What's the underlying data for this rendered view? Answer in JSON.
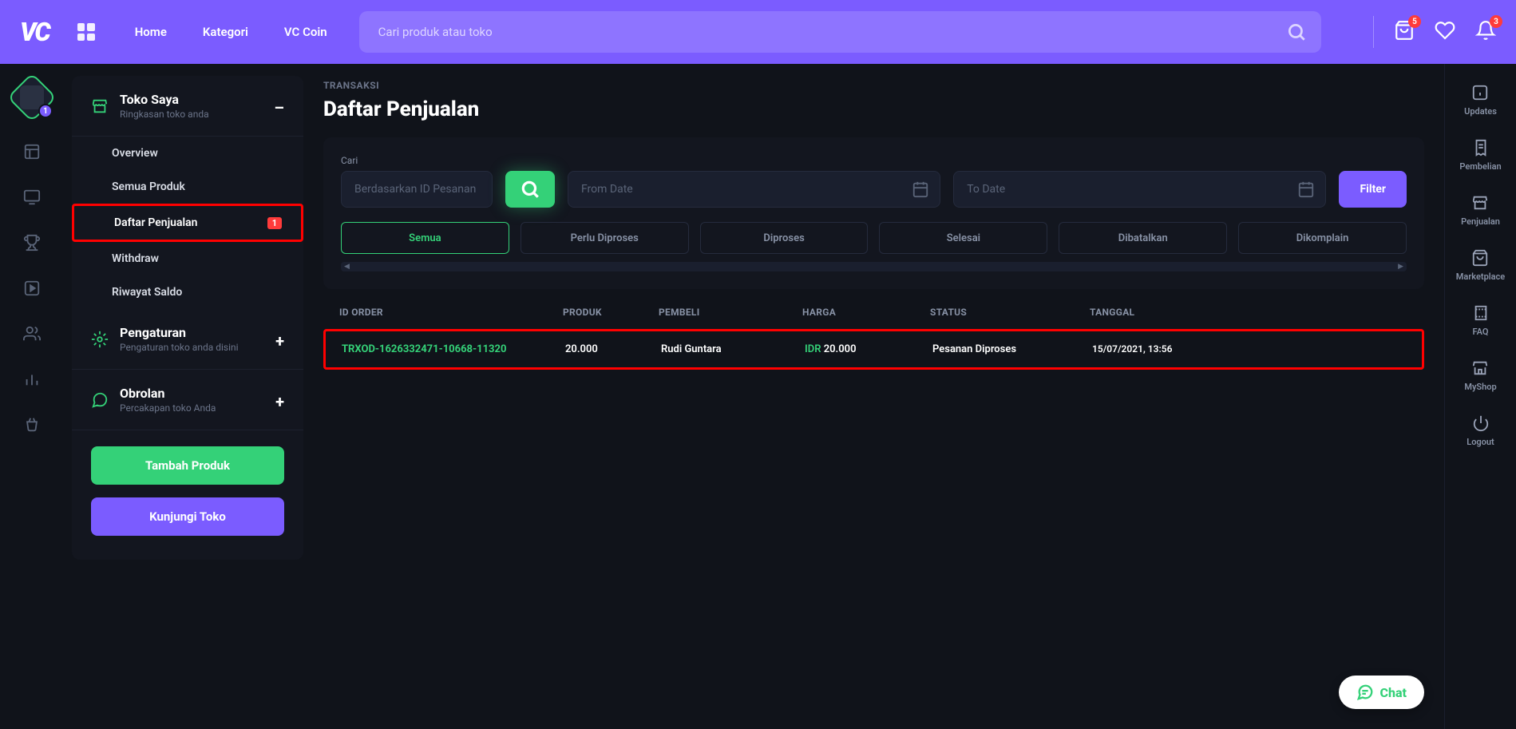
{
  "topnav": {
    "links": [
      "Home",
      "Kategori",
      "VC Coin"
    ],
    "search_placeholder": "Cari produk atau toko",
    "cart_badge": "5",
    "bell_badge": "3"
  },
  "left_rail": {
    "avatar_badge": "1"
  },
  "sidebar": {
    "sections": [
      {
        "title": "Toko Saya",
        "subtitle": "Ringkasan toko anda",
        "collapse": "–"
      },
      {
        "title": "Pengaturan",
        "subtitle": "Pengaturan toko anda disini",
        "collapse": "+"
      },
      {
        "title": "Obrolan",
        "subtitle": "Percakapan toko Anda",
        "collapse": "+"
      }
    ],
    "menu": [
      {
        "label": "Overview"
      },
      {
        "label": "Semua Produk"
      },
      {
        "label": "Daftar Penjualan",
        "badge": "1"
      },
      {
        "label": "Withdraw"
      },
      {
        "label": "Riwayat Saldo"
      }
    ],
    "btn_add": "Tambah Produk",
    "btn_visit": "Kunjungi Toko"
  },
  "main": {
    "breadcrumb": "TRANSAKSI",
    "title": "Daftar Penjualan",
    "search_label": "Cari",
    "search_placeholder": "Berdasarkan ID Pesanan",
    "from_placeholder": "From Date",
    "to_placeholder": "To Date",
    "filter_btn": "Filter",
    "tabs": [
      "Semua",
      "Perlu Diproses",
      "Diproses",
      "Selesai",
      "Dibatalkan",
      "Dikomplain"
    ],
    "headers": {
      "id": "ID ORDER",
      "produk": "PRODUK",
      "pembeli": "PEMBELI",
      "harga": "HARGA",
      "status": "STATUS",
      "tanggal": "TANGGAL"
    },
    "row": {
      "id": "TRXOD-1626332471-10668-11320",
      "produk": "20.000",
      "pembeli": "Rudi Guntara",
      "harga_currency": "IDR",
      "harga_value": "20.000",
      "status": "Pesanan Diproses",
      "tanggal": "15/07/2021, 13:56"
    }
  },
  "right_rail": [
    "Updates",
    "Pembelian",
    "Penjualan",
    "Marketplace",
    "FAQ",
    "MyShop",
    "Logout"
  ],
  "chat": "Chat"
}
